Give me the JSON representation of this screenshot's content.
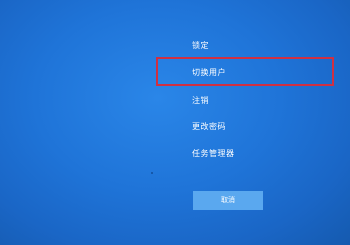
{
  "menu": {
    "items": [
      {
        "label": "锁定"
      },
      {
        "label": "切换用户"
      },
      {
        "label": "注销"
      },
      {
        "label": "更改密码"
      },
      {
        "label": "任务管理器"
      }
    ]
  },
  "cancel_label": "取消",
  "colors": {
    "background": "#1f74d8",
    "highlight_border": "#d03042",
    "cancel_button": "#5aa8ef",
    "text": "#ffffff"
  }
}
